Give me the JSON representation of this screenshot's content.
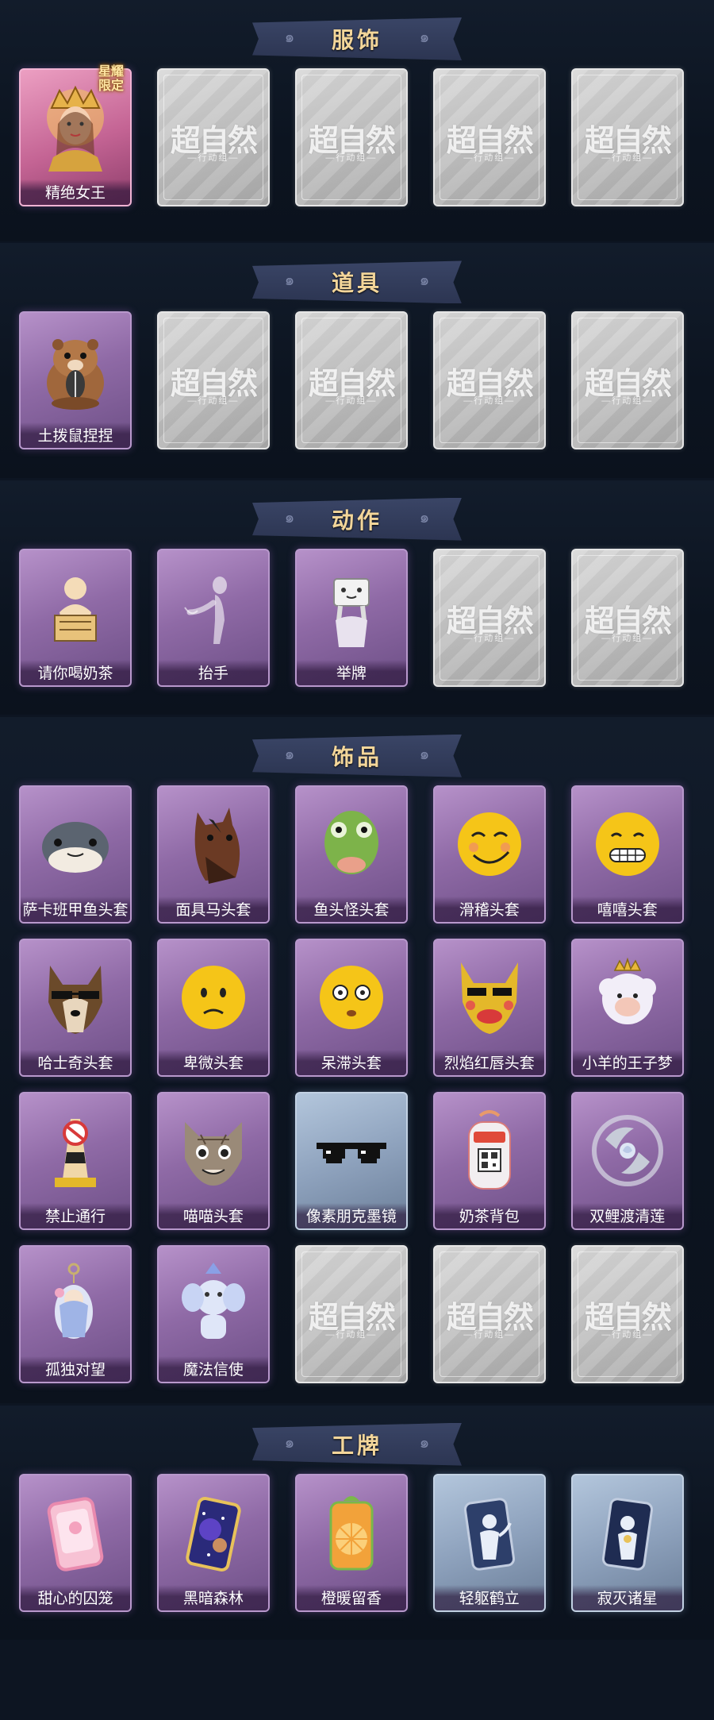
{
  "watermark": {
    "main": "超自然",
    "sub": "—行动组—"
  },
  "sections": [
    {
      "title": "服饰",
      "items": [
        {
          "label": "精绝女王",
          "rarity": "legend",
          "icon": "queen-icon",
          "badge": "星耀\n限定"
        },
        {
          "label": "",
          "rarity": "empty"
        },
        {
          "label": "",
          "rarity": "empty"
        },
        {
          "label": "",
          "rarity": "empty"
        },
        {
          "label": "",
          "rarity": "empty"
        }
      ]
    },
    {
      "title": "道具",
      "items": [
        {
          "label": "土拨鼠捏捏",
          "rarity": "rare",
          "icon": "groundhog-icon"
        },
        {
          "label": "",
          "rarity": "empty"
        },
        {
          "label": "",
          "rarity": "empty"
        },
        {
          "label": "",
          "rarity": "empty"
        },
        {
          "label": "",
          "rarity": "empty"
        }
      ]
    },
    {
      "title": "动作",
      "items": [
        {
          "label": "请你喝奶茶",
          "rarity": "rare",
          "icon": "milktea-gesture-icon"
        },
        {
          "label": "抬手",
          "rarity": "rare",
          "icon": "raise-hand-icon"
        },
        {
          "label": "举牌",
          "rarity": "rare",
          "icon": "hold-sign-icon"
        },
        {
          "label": "",
          "rarity": "empty"
        },
        {
          "label": "",
          "rarity": "empty"
        }
      ]
    },
    {
      "title": "饰品",
      "items": [
        {
          "label": "萨卡班甲鱼头套",
          "rarity": "rare",
          "icon": "fish-mask-icon"
        },
        {
          "label": "面具马头套",
          "rarity": "rare",
          "icon": "horse-mask-icon"
        },
        {
          "label": "鱼头怪头套",
          "rarity": "rare",
          "icon": "fishhead-mask-icon"
        },
        {
          "label": "滑稽头套",
          "rarity": "rare",
          "icon": "funny-emoji-icon"
        },
        {
          "label": "嘻嘻头套",
          "rarity": "rare",
          "icon": "grin-emoji-icon"
        },
        {
          "label": "哈士奇头套",
          "rarity": "rare",
          "icon": "husky-mask-icon"
        },
        {
          "label": "卑微头套",
          "rarity": "rare",
          "icon": "humble-emoji-icon"
        },
        {
          "label": "呆滞头套",
          "rarity": "rare",
          "icon": "dazed-emoji-icon"
        },
        {
          "label": "烈焰红唇头套",
          "rarity": "rare",
          "icon": "redlips-mask-icon"
        },
        {
          "label": "小羊的王子梦",
          "rarity": "rare",
          "icon": "sheep-prince-icon"
        },
        {
          "label": "禁止通行",
          "rarity": "rare",
          "icon": "traffic-cone-icon"
        },
        {
          "label": "喵喵头套",
          "rarity": "rare",
          "icon": "cat-mask-icon"
        },
        {
          "label": "像素朋克墨镜",
          "rarity": "blue",
          "icon": "pixel-sunglasses-icon"
        },
        {
          "label": "奶茶背包",
          "rarity": "rare",
          "icon": "milktea-backpack-icon"
        },
        {
          "label": "双鲤渡清莲",
          "rarity": "rare",
          "icon": "koi-lotus-icon"
        },
        {
          "label": "孤独对望",
          "rarity": "rare",
          "icon": "charm-pendant-icon"
        },
        {
          "label": "魔法信使",
          "rarity": "rare",
          "icon": "elephant-messenger-icon"
        },
        {
          "label": "",
          "rarity": "empty"
        },
        {
          "label": "",
          "rarity": "empty"
        },
        {
          "label": "",
          "rarity": "empty"
        }
      ]
    },
    {
      "title": "工牌",
      "items": [
        {
          "label": "甜心的囚笼",
          "rarity": "rare",
          "icon": "pink-badge-icon"
        },
        {
          "label": "黑暗森林",
          "rarity": "rare",
          "icon": "galaxy-badge-icon"
        },
        {
          "label": "橙暖留香",
          "rarity": "rare",
          "icon": "orange-badge-icon"
        },
        {
          "label": "轻躯鹤立",
          "rarity": "blue",
          "icon": "silhouette-badge-icon"
        },
        {
          "label": "寂灭诸星",
          "rarity": "blue",
          "icon": "star-badge-icon"
        }
      ]
    }
  ]
}
